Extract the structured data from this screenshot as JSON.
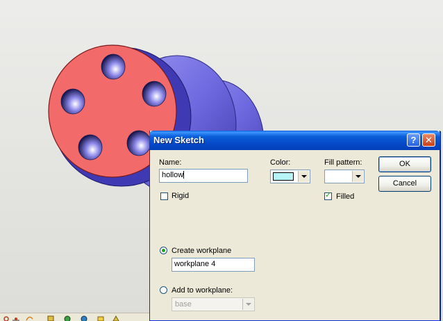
{
  "dialog": {
    "title": "New Sketch",
    "help_glyph": "?",
    "close_glyph": "✕",
    "name_label": "Name:",
    "name_value": "hollow",
    "color_label": "Color:",
    "color_value": "#b6f4f8",
    "fill_pattern_label": "Fill pattern:",
    "rigid_label": "Rigid",
    "rigid_checked": false,
    "filled_label": "Filled",
    "filled_checked": true,
    "create_workplane_label": "Create workplane",
    "create_workplane_value": "workplane 4",
    "add_to_workplane_label": "Add to workplane:",
    "add_to_workplane_value": "base",
    "selected_option": "create_workplane",
    "ok_label": "OK",
    "cancel_label": "Cancel"
  },
  "colors": {
    "titlebar": "#0a5fd8",
    "dialog_bg": "#ece9d8",
    "face_red": "#f26a6a",
    "body_blue": "#6f6ae0",
    "viewport_bg": "#e4e4e0"
  },
  "toolbar": {
    "icons": [
      "tool-icon-1",
      "tool-icon-2",
      "tool-icon-3",
      "tool-icon-4",
      "tool-icon-5",
      "tool-icon-6",
      "tool-icon-7",
      "tool-icon-8"
    ]
  }
}
